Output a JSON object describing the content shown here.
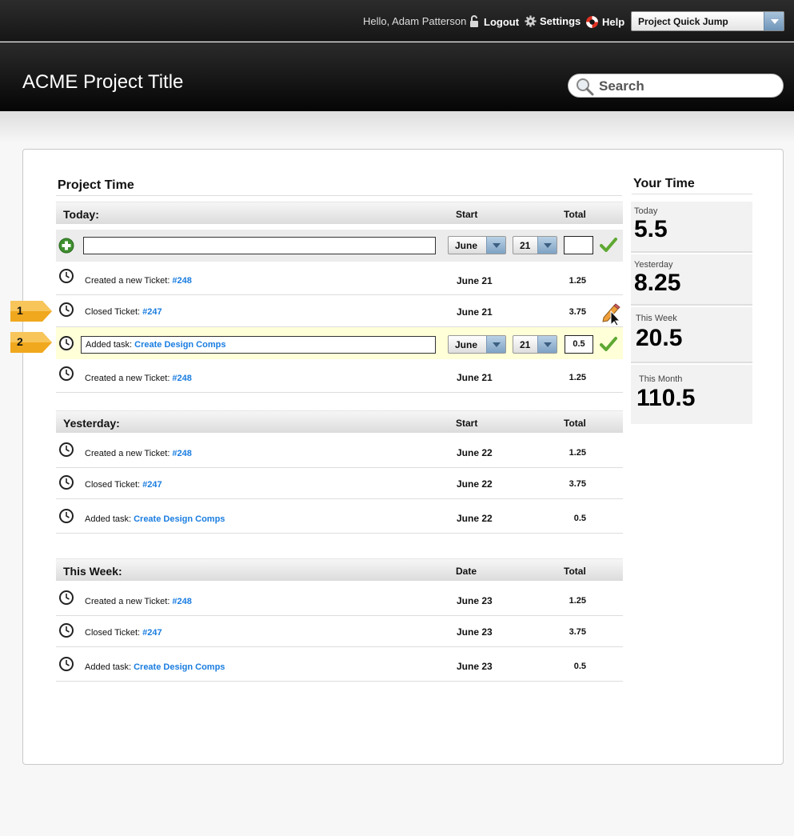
{
  "topbar": {
    "greeting": "Hello, Adam Patterson",
    "logout_label": "Logout",
    "settings_label": "Settings",
    "help_label": "Help",
    "quick_jump_label": "Project Quick Jump"
  },
  "header": {
    "project_title": "ACME Project Title",
    "search_placeholder": "Search"
  },
  "project_time": {
    "title": "Project Time",
    "today": {
      "label": "Today:",
      "col_start": "Start",
      "col_total": "Total",
      "new_entry": {
        "month": "June",
        "day": "21",
        "total": ""
      },
      "rows": [
        {
          "text": "Created a new Ticket:",
          "link": "#248",
          "date": "June 21",
          "total": "1.25"
        },
        {
          "text": "Closed Ticket:",
          "link": "#247",
          "date": "June 21",
          "total": "3.75"
        },
        {
          "text": "Added task:",
          "link": "Create Design Comps",
          "month": "June",
          "day": "21",
          "total": "0.5"
        },
        {
          "text": "Created a new Ticket:",
          "link": "#248",
          "date": "June 21",
          "total": "1.25"
        }
      ]
    },
    "yesterday": {
      "label": "Yesterday:",
      "col_start": "Start",
      "col_total": "Total",
      "rows": [
        {
          "text": "Created a new Ticket:",
          "link": "#248",
          "date": "June 22",
          "total": "1.25"
        },
        {
          "text": "Closed Ticket:",
          "link": "#247",
          "date": "June 22",
          "total": "3.75"
        },
        {
          "text": "Added task:",
          "link": "Create Design Comps",
          "date": "June 22",
          "total": "0.5"
        }
      ]
    },
    "this_week": {
      "label": "This Week:",
      "col_date": "Date",
      "col_total": "Total",
      "rows": [
        {
          "text": "Created a new Ticket:",
          "link": "#248",
          "date": "June 23",
          "total": "1.25"
        },
        {
          "text": "Closed Ticket:",
          "link": "#247",
          "date": "June 23",
          "total": "3.75"
        },
        {
          "text": "Added task:",
          "link": "Create Design Comps",
          "date": "June 23",
          "total": "0.5"
        }
      ]
    }
  },
  "annotations": [
    "1",
    "2"
  ],
  "your_time": {
    "title": "Your Time",
    "stats": [
      {
        "label": "Today",
        "value": "5.5"
      },
      {
        "label": "Yesterday",
        "value": "8.25"
      },
      {
        "label": "This Week",
        "value": "20.5"
      },
      {
        "label": "This Month",
        "value": "110.5"
      }
    ]
  },
  "colors": {
    "link": "#1a7de0",
    "edit_highlight": "#ffffd8",
    "marker": "#f0a81e"
  }
}
